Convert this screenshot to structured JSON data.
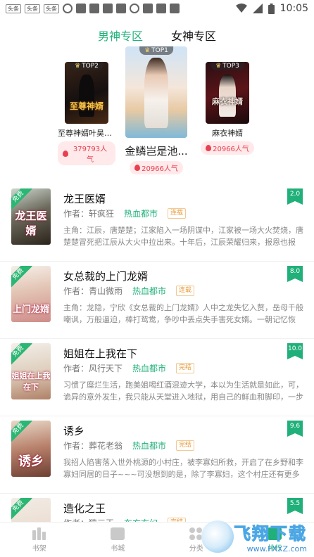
{
  "status_bar": {
    "chips": [
      "头条",
      "头条",
      "头条"
    ],
    "time": "10:05"
  },
  "tabs": [
    {
      "label": "男神专区",
      "active": true
    },
    {
      "label": "女神专区",
      "active": false
    }
  ],
  "top_ranking": {
    "top2": {
      "badge": "TOP2",
      "title": "至尊神婿叶昊郑...",
      "cover_text": "至尊神婿",
      "popularity": "379793人气"
    },
    "top1": {
      "badge": "TOP1",
      "title": "金鳞岂是池...",
      "popularity": "20966人气"
    },
    "top3": {
      "badge": "TOP3",
      "title": "麻衣神婿",
      "cover_text": "麻衣神婿",
      "popularity": "20966人气"
    }
  },
  "books": [
    {
      "title": "龙王医婿",
      "author_label": "作者：",
      "author": "轩疯狂",
      "genre": "热血都市",
      "status": "连载",
      "score": "2.0",
      "ribbon": "免费",
      "cover_text": "龙王医婿",
      "desc": "主角：江辰，唐楚楚；江家陷入一场阴谋中，江家被一场大火焚烧，唐楚楚冒死把江辰从大火中拉出来。十年后，江辰荣耀归来，报恩也报仇。报..."
    },
    {
      "title": "女总裁的上门龙婿",
      "author_label": "作者：",
      "author": "青山微雨",
      "genre": "热血都市",
      "status": "连载",
      "score": "8.0",
      "ribbon": "免费",
      "cover_text": "上门龙婿",
      "desc": "主角：龙隐，宁欣《女总裁的上门龙婿》人中之龙失忆入赘，岳母千般嘲讽，万般逼迫，棒打鸳鸯，争吵中丢点失手害死女婿。一朝记忆恢复，权..."
    },
    {
      "title": "姐姐在上我在下",
      "author_label": "作者：",
      "author": "风行天下",
      "genre": "热血都市",
      "status": "完结",
      "score": "10.0",
      "ribbon": "免费",
      "cover_text": "姐姐在上我在下",
      "desc": "习惯了糜烂生活，跑美姐喝红酒混迹大学，本以为生活就是如此，可，诡异的意外发生，我只能从天堂进入地狱，用自己的鲜血和脚印，一步步踩..."
    },
    {
      "title": "诱乡",
      "author_label": "作者：",
      "author": "葬花老翁",
      "genre": "热血都市",
      "status": "完结",
      "score": "9.6",
      "ribbon": "免费",
      "cover_text": "诱乡",
      "desc": "我招人陷害落入世外桃源的小村庄，被李寡妇所救，开启了在乡野和李寡妇同居的日子~~~可没想到的是，除了李寡妇，这个村庄还有更多的美村..."
    },
    {
      "title": "造化之王",
      "author_label": "作者：",
      "author": "猿三王",
      "genre": "东方玄幻",
      "status": "完结",
      "score": "5.5",
      "ribbon": "免费",
      "cover_text": "",
      "desc": ""
    }
  ],
  "bottom_nav": [
    {
      "label": "书架",
      "icon": "bookshelf-icon"
    },
    {
      "label": "书城",
      "icon": "book-icon"
    },
    {
      "label": "分类",
      "icon": "category-icon"
    },
    {
      "label": "排行",
      "icon": "ranking-icon",
      "active": true
    }
  ],
  "watermark": {
    "main": "飞翔下载",
    "sub": "www.FXXZ.com"
  },
  "colors": {
    "accent": "#21b07a",
    "popularity": "#e84050",
    "status_tag": "#e89a3b"
  }
}
